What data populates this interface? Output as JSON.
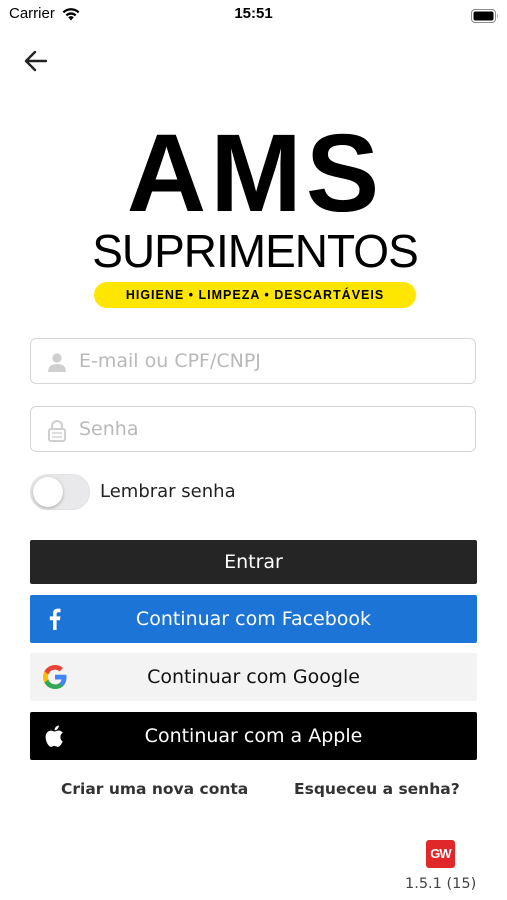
{
  "status_bar": {
    "carrier": "Carrier",
    "time": "15:51"
  },
  "logo": {
    "line1": "AMS",
    "line2": "SUPRIMENTOS",
    "tagline": "HIGIENE  •  LIMPEZA  •  DESCARTÁVEIS",
    "tagline_color": "#ffe600"
  },
  "login_form": {
    "email_placeholder": "E-mail ou CPF/CNPJ",
    "email_value": "",
    "password_placeholder": "Senha",
    "password_value": "",
    "remember_label": "Lembrar senha",
    "remember_on": false
  },
  "buttons": {
    "enter": "Entrar",
    "facebook": "Continuar com Facebook",
    "google": "Continuar com Google",
    "apple": "Continuar com a Apple"
  },
  "colors": {
    "enter_bg": "#252525",
    "facebook_bg": "#1c74d6",
    "google_bg": "#f3f3f3",
    "apple_bg": "#000000",
    "gw_badge": "#e0272a"
  },
  "links": {
    "create_account": "Criar uma nova conta",
    "forgot_password": "Esqueceu a senha?"
  },
  "footer": {
    "badge_logo": "GW",
    "version": "1.5.1 (15)"
  }
}
